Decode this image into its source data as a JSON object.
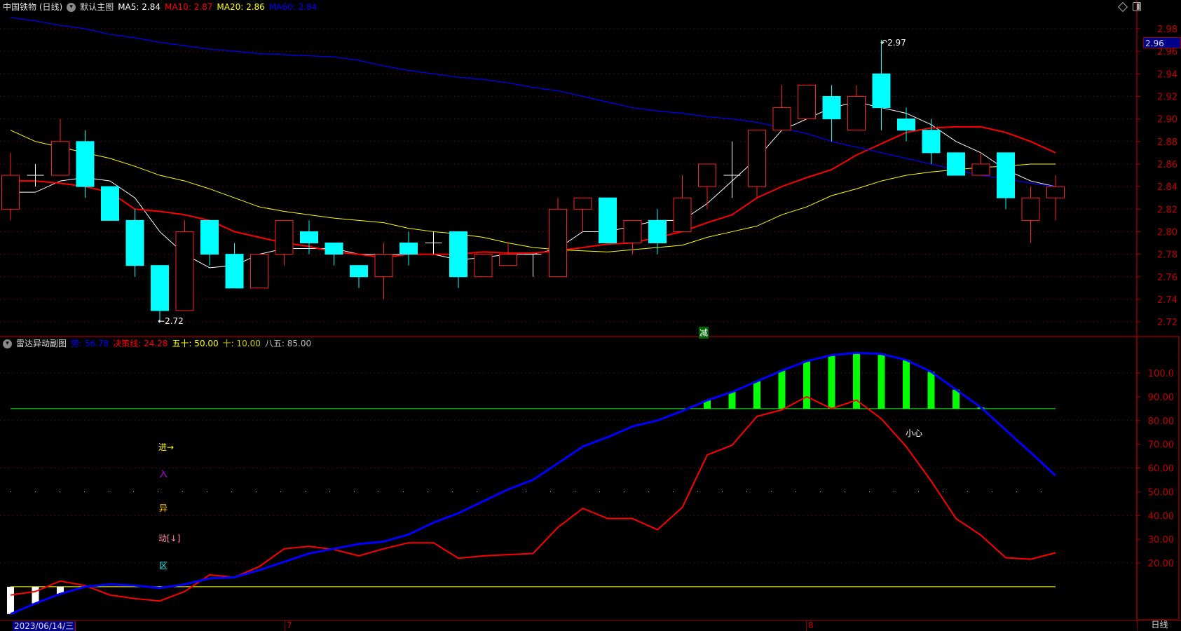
{
  "main_header": {
    "title": "中国铁物 (日线)",
    "template": "默认主图",
    "ma5": "MA5: 2.84",
    "ma10": "MA10: 2.87",
    "ma20": "MA20: 2.86",
    "ma60": "MA60: 2.84",
    "icons": [
      "diamond-icon",
      "panel-toggle-icon",
      "dropdown-icon"
    ]
  },
  "sub_header": {
    "title": "雷达异动副图",
    "shi": "势: 56.78",
    "juece": "决策线: 24.28",
    "wushi": "五十: 50.00",
    "shi10": "十: 10.00",
    "bawu": "八五: 85.00"
  },
  "colors": {
    "up": "#ff2020",
    "down": "#00ffff",
    "ma5": "#ffffff",
    "ma10": "#ff0000",
    "ma20": "#ffff00",
    "ma60": "#0000ff",
    "shi": "#0000ff",
    "juece": "#ff0000",
    "bar": "#00ff00",
    "axis": "#c00000"
  },
  "annotations": {
    "high": "2.97",
    "low": "2.72",
    "jian": "减",
    "xiaoxin": "小心",
    "jin": "进→",
    "ru": "入",
    "yi": "异",
    "dong": "动[↓]",
    "qu": "区"
  },
  "current_price_tag": "2.96",
  "date_axis": {
    "first": "2023/06/14/三",
    "month7": "7",
    "month8": "8",
    "period": "日线"
  },
  "chart_data": [
    {
      "type": "candlestick",
      "ylim": [
        2.71,
        2.99
      ],
      "yticks": [
        "2.98",
        "2.96",
        "2.94",
        "2.92",
        "2.90",
        "2.88",
        "2.86",
        "2.84",
        "2.82",
        "2.80",
        "2.78",
        "2.76",
        "2.74",
        "2.72"
      ],
      "ohlc": [
        [
          2.82,
          2.87,
          2.81,
          2.85
        ],
        [
          2.85,
          2.86,
          2.84,
          2.85
        ],
        [
          2.85,
          2.9,
          2.85,
          2.88
        ],
        [
          2.88,
          2.89,
          2.83,
          2.84
        ],
        [
          2.84,
          2.84,
          2.81,
          2.81
        ],
        [
          2.81,
          2.82,
          2.76,
          2.77
        ],
        [
          2.77,
          2.77,
          2.72,
          2.73
        ],
        [
          2.73,
          2.81,
          2.73,
          2.8
        ],
        [
          2.81,
          2.81,
          2.77,
          2.78
        ],
        [
          2.78,
          2.79,
          2.75,
          2.75
        ],
        [
          2.75,
          2.78,
          2.75,
          2.78
        ],
        [
          2.78,
          2.81,
          2.77,
          2.81
        ],
        [
          2.8,
          2.81,
          2.78,
          2.79
        ],
        [
          2.79,
          2.79,
          2.77,
          2.78
        ],
        [
          2.77,
          2.77,
          2.75,
          2.76
        ],
        [
          2.76,
          2.79,
          2.74,
          2.78
        ],
        [
          2.79,
          2.8,
          2.77,
          2.78
        ],
        [
          2.79,
          2.8,
          2.78,
          2.79
        ],
        [
          2.8,
          2.8,
          2.75,
          2.76
        ],
        [
          2.76,
          2.78,
          2.76,
          2.78
        ],
        [
          2.77,
          2.79,
          2.77,
          2.78
        ],
        [
          2.78,
          2.78,
          2.76,
          2.78
        ],
        [
          2.76,
          2.83,
          2.76,
          2.82
        ],
        [
          2.82,
          2.83,
          2.8,
          2.83
        ],
        [
          2.83,
          2.83,
          2.79,
          2.79
        ],
        [
          2.79,
          2.81,
          2.78,
          2.81
        ],
        [
          2.81,
          2.82,
          2.78,
          2.79
        ],
        [
          2.8,
          2.85,
          2.8,
          2.83
        ],
        [
          2.84,
          2.86,
          2.82,
          2.86
        ],
        [
          2.85,
          2.88,
          2.83,
          2.85
        ],
        [
          2.84,
          2.89,
          2.83,
          2.89
        ],
        [
          2.89,
          2.93,
          2.89,
          2.91
        ],
        [
          2.9,
          2.93,
          2.9,
          2.93
        ],
        [
          2.92,
          2.93,
          2.88,
          2.9
        ],
        [
          2.89,
          2.93,
          2.89,
          2.92
        ],
        [
          2.94,
          2.97,
          2.89,
          2.91
        ],
        [
          2.9,
          2.91,
          2.88,
          2.89
        ],
        [
          2.89,
          2.9,
          2.86,
          2.87
        ],
        [
          2.87,
          2.87,
          2.85,
          2.85
        ],
        [
          2.85,
          2.87,
          2.85,
          2.86
        ],
        [
          2.87,
          2.87,
          2.82,
          2.83
        ],
        [
          2.81,
          2.84,
          2.79,
          2.83
        ],
        [
          2.83,
          2.85,
          2.81,
          2.84
        ]
      ],
      "series": [
        {
          "name": "MA5",
          "values": [
            2.835,
            2.835,
            2.845,
            2.848,
            2.845,
            2.83,
            2.8,
            2.78,
            2.768,
            2.77,
            2.78,
            2.785,
            2.785,
            2.785,
            2.78,
            2.78,
            2.78,
            2.78,
            2.775,
            2.777,
            2.78,
            2.78,
            2.785,
            2.8,
            2.8,
            2.805,
            2.81,
            2.81,
            2.825,
            2.845,
            2.865,
            2.89,
            2.9,
            2.91,
            2.915,
            2.91,
            2.905,
            2.895,
            2.88,
            2.87,
            2.855,
            2.845,
            2.84
          ]
        },
        {
          "name": "MA10",
          "values": [
            2.845,
            2.845,
            2.843,
            2.84,
            2.835,
            2.82,
            2.818,
            2.815,
            2.81,
            2.8,
            2.795,
            2.79,
            2.787,
            2.782,
            2.78,
            2.777,
            2.78,
            2.78,
            2.78,
            2.782,
            2.781,
            2.781,
            2.783,
            2.786,
            2.789,
            2.79,
            2.795,
            2.8,
            2.808,
            2.815,
            2.83,
            2.84,
            2.848,
            2.855,
            2.868,
            2.878,
            2.888,
            2.892,
            2.893,
            2.893,
            2.888,
            2.88,
            2.87
          ]
        },
        {
          "name": "MA20",
          "values": [
            2.89,
            2.88,
            2.875,
            2.87,
            2.865,
            2.858,
            2.85,
            2.845,
            2.838,
            2.83,
            2.822,
            2.818,
            2.815,
            2.812,
            2.81,
            2.808,
            2.803,
            2.8,
            2.798,
            2.795,
            2.79,
            2.786,
            2.784,
            2.783,
            2.782,
            2.784,
            2.786,
            2.788,
            2.795,
            2.8,
            2.805,
            2.815,
            2.822,
            2.832,
            2.838,
            2.845,
            2.85,
            2.853,
            2.855,
            2.857,
            2.858,
            2.86,
            2.86
          ]
        },
        {
          "name": "MA60",
          "values": [
            2.99,
            2.987,
            2.983,
            2.98,
            2.975,
            2.972,
            2.968,
            2.965,
            2.962,
            2.96,
            2.958,
            2.957,
            2.956,
            2.955,
            2.952,
            2.947,
            2.943,
            2.94,
            2.937,
            2.935,
            2.932,
            2.928,
            2.925,
            2.92,
            2.915,
            2.91,
            2.907,
            2.905,
            2.902,
            2.9,
            2.897,
            2.892,
            2.887,
            2.88,
            2.875,
            2.87,
            2.865,
            2.86,
            2.855,
            2.85,
            2.847,
            2.843,
            2.84
          ]
        }
      ]
    },
    {
      "type": "line",
      "ylim": [
        -3,
        112
      ],
      "yticks": [
        "100.0",
        "90.00",
        "80.00",
        "70.00",
        "60.00",
        "50.00",
        "40.00",
        "30.00",
        "20.00"
      ],
      "hlines": {
        "bawu": 85,
        "wushi": 50,
        "shi": 10
      },
      "series": [
        {
          "name": "势",
          "values": [
            -1.5,
            3,
            7,
            10,
            11,
            10.5,
            9.5,
            11,
            13.5,
            14,
            17,
            20.5,
            24,
            26,
            28,
            29,
            32,
            37,
            41,
            46,
            51,
            55,
            62,
            69,
            73,
            77.5,
            80,
            84,
            88.5,
            92,
            96.5,
            101,
            105,
            107.5,
            108.5,
            108,
            105.5,
            100.5,
            93,
            85.5,
            76,
            66.5,
            56.78
          ]
        },
        {
          "name": "决策线",
          "values": [
            6.5,
            8,
            12.4,
            10.5,
            6.5,
            5,
            4,
            8,
            15,
            14,
            18.5,
            26,
            27,
            25.7,
            23,
            26,
            28.5,
            28.5,
            22,
            23,
            23.5,
            24,
            35,
            43,
            38.7,
            38.7,
            34,
            43.4,
            65.5,
            69.6,
            81.7,
            84.5,
            90,
            85,
            88.6,
            80.7,
            69,
            54.5,
            38.7,
            31.7,
            22.2,
            21.6,
            24.28
          ]
        }
      ]
    }
  ]
}
